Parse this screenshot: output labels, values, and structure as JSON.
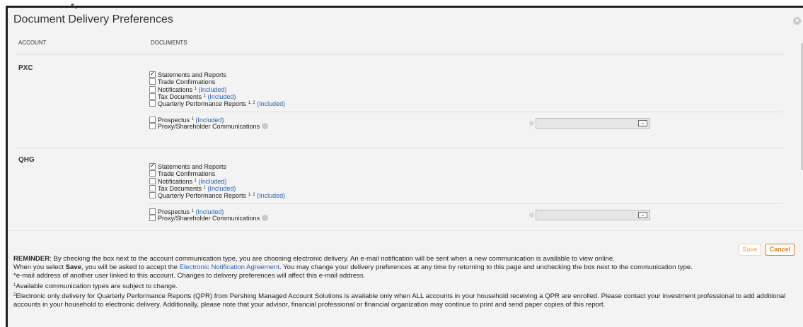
{
  "dialog": {
    "title": "Document Delivery Preferences",
    "close_icon": "close-circle-icon"
  },
  "table": {
    "col_account": "ACCOUNT",
    "col_documents": "DOCUMENTS"
  },
  "accounts": [
    {
      "name": "PXC",
      "docs": [
        {
          "label": "Statements and Reports",
          "checked": true,
          "sup": "",
          "included": ""
        },
        {
          "label": "Trade Confirmations",
          "checked": false,
          "sup": "",
          "included": ""
        },
        {
          "label": "Notifications",
          "checked": false,
          "sup": "1",
          "included": "(Included)"
        },
        {
          "label": "Tax Documents",
          "checked": false,
          "sup": "1",
          "included": "(Included)"
        },
        {
          "label": "Quarterly Performance Reports",
          "checked": false,
          "sup": "1, 2",
          "included": "(Included)"
        }
      ],
      "extra": [
        {
          "label": "Prospectus",
          "checked": false,
          "sup": "1",
          "included": "(Included)"
        },
        {
          "label": "Proxy/Shareholder Communications",
          "checked": false,
          "sup": "",
          "included": "",
          "info": "info-icon"
        }
      ],
      "select_value": ""
    },
    {
      "name": "QHG",
      "docs": [
        {
          "label": "Statements and Reports",
          "checked": true,
          "sup": "",
          "included": ""
        },
        {
          "label": "Trade Confirmations",
          "checked": false,
          "sup": "",
          "included": ""
        },
        {
          "label": "Notifications",
          "checked": false,
          "sup": "1",
          "included": "(Included)"
        },
        {
          "label": "Tax Documents",
          "checked": false,
          "sup": "1",
          "included": "(Included)"
        },
        {
          "label": "Quarterly Performance Reports",
          "checked": false,
          "sup": "1, 2",
          "included": "(Included)"
        }
      ],
      "extra": [
        {
          "label": "Prospectus",
          "checked": false,
          "sup": "1",
          "included": "(Included)"
        },
        {
          "label": "Proxy/Shareholder Communications",
          "checked": false,
          "sup": "",
          "included": "",
          "info": "info-icon"
        }
      ],
      "select_value": ""
    }
  ],
  "buttons": {
    "save": "Save",
    "cancel": "Cancel"
  },
  "notes": {
    "reminder_label": "REMINDER",
    "reminder_text": ": By checking the box next to the account communication type, you are choosing electronic delivery. An e-mail notification will be sent when a new communication is available to view online.",
    "line2_a": "When you select ",
    "line2_bold": "Save",
    "line2_b": ", you will be asked to accept the ",
    "line2_link": "Electronic Notification Agreement",
    "line2_c": ". You may change your delivery preferences at any time by returning to this page and unchecking the box next to the communication type.",
    "line3": "*e-mail address of another user linked to this account. Changes to delivery preferences will affect this e-mail address.",
    "line4_sup": "1",
    "line4": "Available communication types are subject to change.",
    "line5_sup": "2",
    "line5": "Electronic only delivery for Quarterly Performance Reports (QPR) from Pershing Managed Account Solutions is available only when ALL accounts in your household receiving a QPR are enrolled. Please contact your investment professional to add additional accounts in your household to electronic delivery. Additionally, please note that your advisor, financial professional or financial organization may continue to print and send paper copies of this report."
  },
  "colors": {
    "link": "#2b5fb3",
    "cancel_accent": "#e07a1d",
    "background": "#f3f3f3"
  }
}
